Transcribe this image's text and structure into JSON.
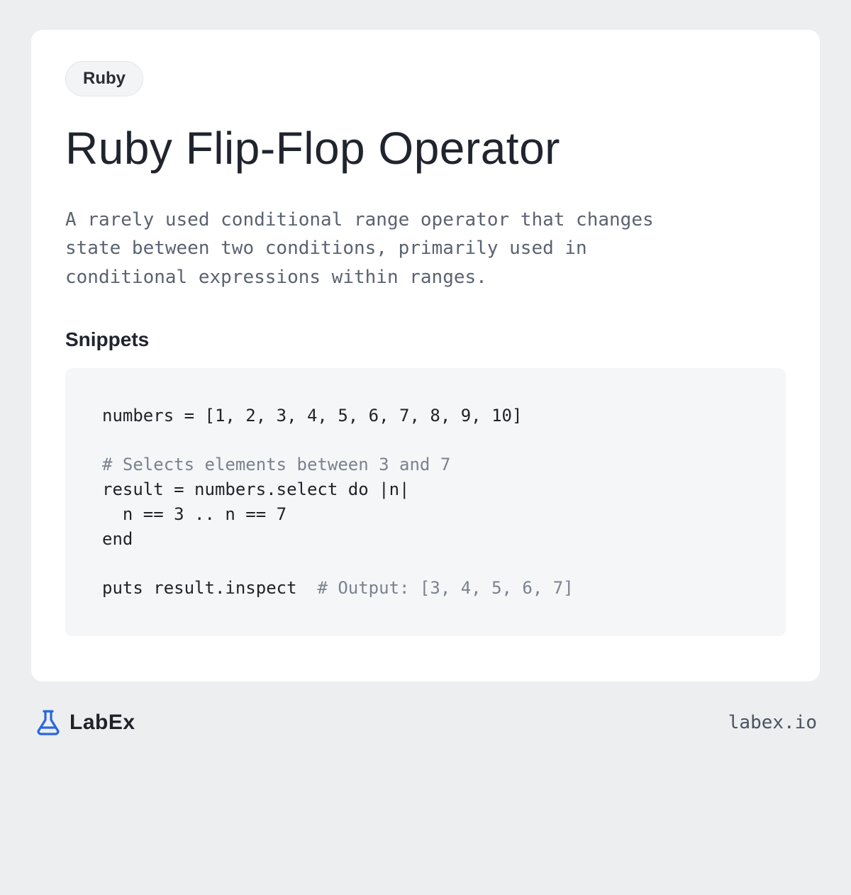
{
  "tag": "Ruby",
  "title": "Ruby Flip-Flop Operator",
  "description": "A rarely used conditional range operator that changes state between two conditions, primarily used in conditional expressions within ranges.",
  "snippets_heading": "Snippets",
  "code": {
    "line1": "numbers = [1, 2, 3, 4, 5, 6, 7, 8, 9, 10]",
    "blank": "",
    "comment1": "# Selects elements between 3 and 7",
    "line2": "result = numbers.select do |n|",
    "line3": "  n == 3 .. n == 7",
    "line4": "end",
    "line5a": "puts result.inspect  ",
    "comment2": "# Output: [3, 4, 5, 6, 7]"
  },
  "footer": {
    "brand": "LabEx",
    "url": "labex.io"
  }
}
